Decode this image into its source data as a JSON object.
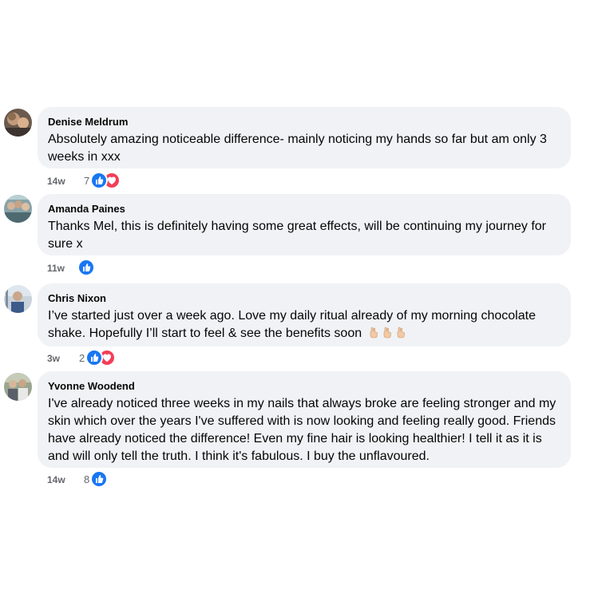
{
  "comments": [
    {
      "author": "Denise Meldrum",
      "text": "Absolutely amazing noticeable difference- mainly noticing my hands so far but am only 3 weeks in xxx",
      "time": "14w",
      "reaction_count": "7",
      "reactions": [
        "like-icon",
        "love-icon"
      ]
    },
    {
      "author": "Amanda Paines",
      "text": "Thanks Mel, this is definitely having some great effects, will be continuing my journey for sure x",
      "time": "11w",
      "reaction_count": "",
      "reactions": [
        "like-icon"
      ]
    },
    {
      "author": "Chris Nixon",
      "text": "I’ve started just over a week ago. Love my daily ritual already of my morning chocolate shake. Hopefully I’ll start to feel & see the benefits soon",
      "text_emojis": [
        "crossed-fingers-icon",
        "crossed-fingers-icon",
        "crossed-fingers-icon"
      ],
      "time": "3w",
      "reaction_count": "2",
      "reactions": [
        "like-icon",
        "love-icon"
      ]
    },
    {
      "author": "Yvonne Woodend",
      "text": "I've already noticed three weeks in my nails that always broke are feeling stronger and my skin which over the years I've suffered with is now looking and feeling really good. Friends have already noticed the difference! Even my fine hair is looking healthier! I tell it as it is and will only tell the truth. I think it's fabulous. I buy the unflavoured.",
      "time": "14w",
      "reaction_count": "8",
      "reactions": [
        "like-icon"
      ]
    }
  ],
  "colors": {
    "bubble": "#f0f2f5",
    "meta": "#65676b",
    "like": "#1877f2",
    "love": "#f33e58"
  }
}
